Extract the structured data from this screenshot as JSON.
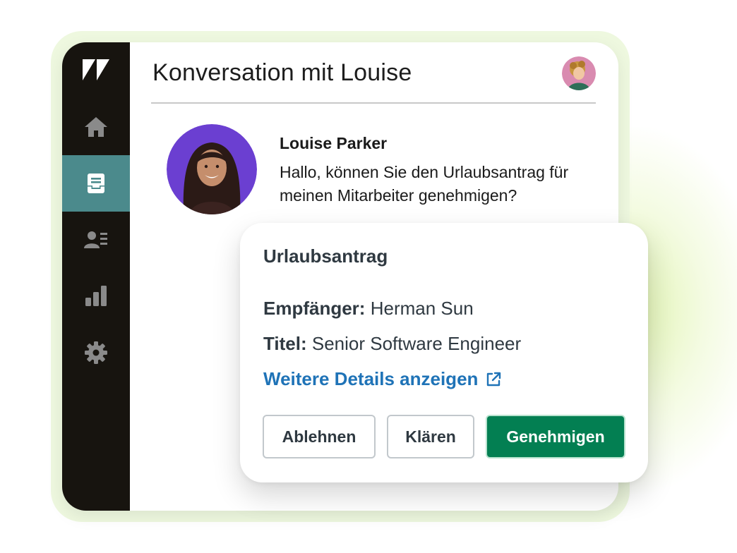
{
  "colors": {
    "sidebar_bg": "#17140f",
    "sidebar_active": "#4b8a8c",
    "primary_button": "#037f52",
    "link": "#1f73b7",
    "text_dark": "#2f3941"
  },
  "sidebar": {
    "logo": "zendesk-logo",
    "items": [
      {
        "icon": "home-icon",
        "active": false
      },
      {
        "icon": "inbox-icon",
        "active": true
      },
      {
        "icon": "contacts-icon",
        "active": false
      },
      {
        "icon": "reporting-icon",
        "active": false
      },
      {
        "icon": "gear-icon",
        "active": false
      }
    ]
  },
  "header": {
    "title": "Konversation mit Louise"
  },
  "message": {
    "sender": "Louise Parker",
    "text": "Hallo, können Sie den Urlaubsantrag für meinen Mitarbeiter genehmigen?"
  },
  "request": {
    "title": "Urlaubsantrag",
    "recipient_label": "Empfänger:",
    "recipient_value": "Herman Sun",
    "title_label": "Titel:",
    "title_value": "Senior Software Engineer",
    "details_link": "Weitere Details anzeigen",
    "buttons": {
      "reject": "Ablehnen",
      "clarify": "Klären",
      "approve": "Genehmigen"
    }
  }
}
